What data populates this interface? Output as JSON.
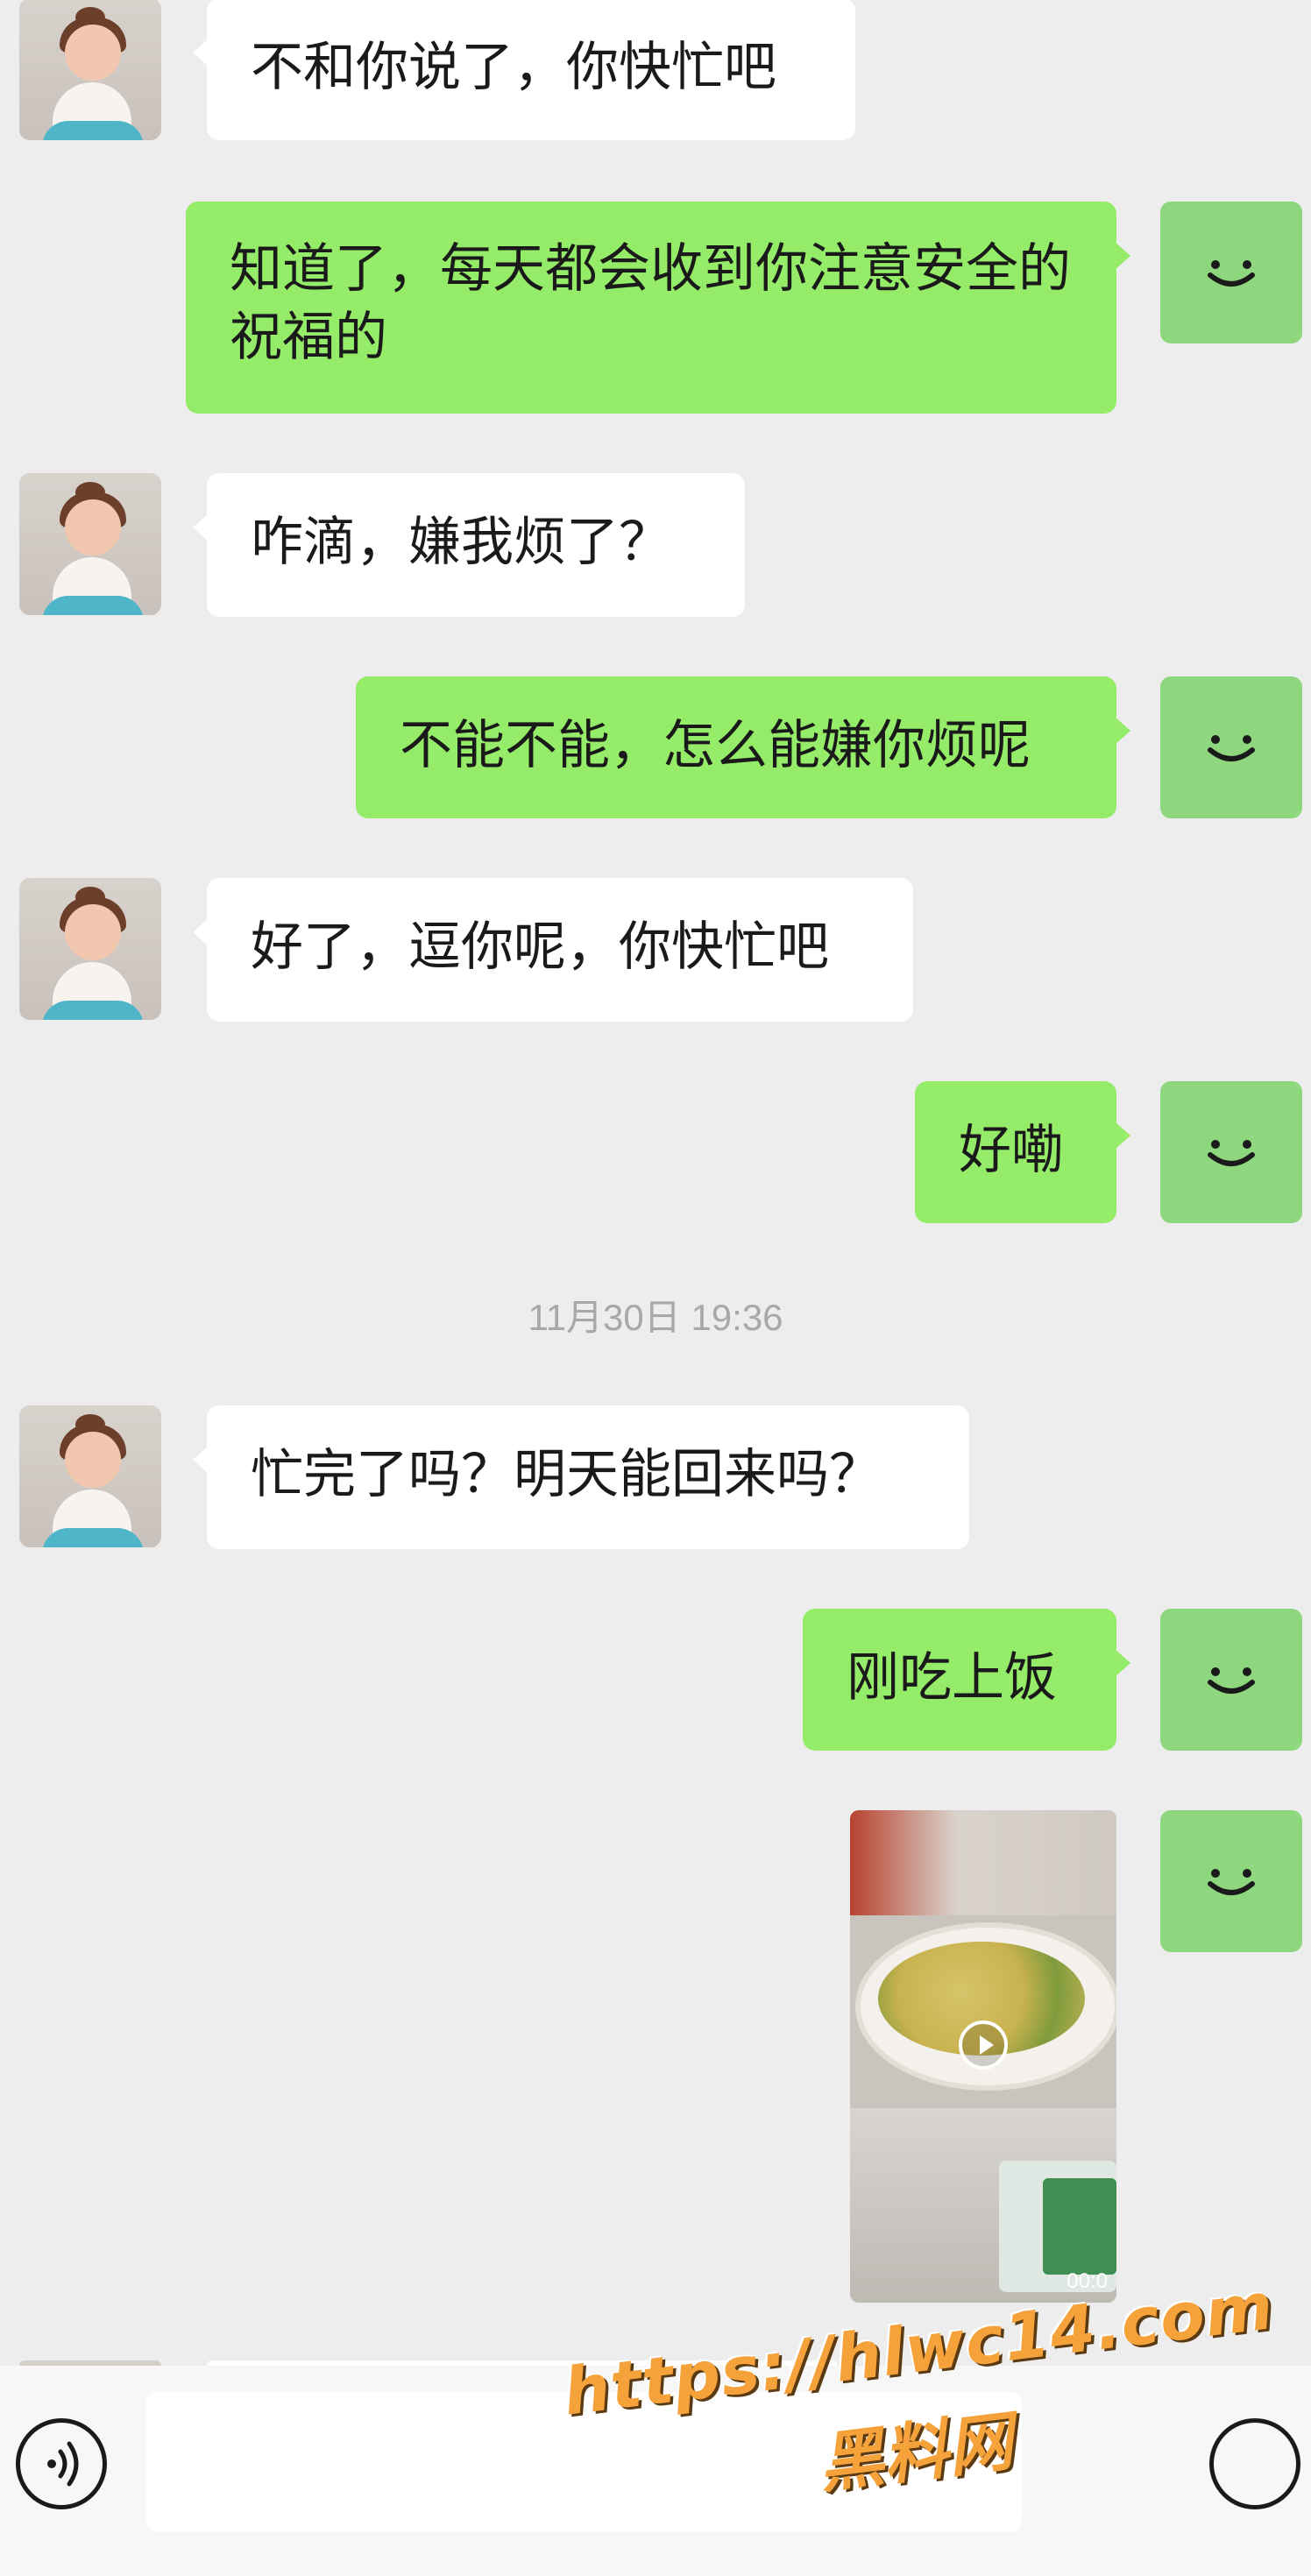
{
  "colors": {
    "background": "#ededed",
    "incoming_bubble": "#ffffff",
    "outgoing_bubble": "#95ec69",
    "my_avatar": "#8ed77e",
    "timestamp_text": "#a8a8a8",
    "watermark": "#f6a23b"
  },
  "messages": [
    {
      "side": "in",
      "text": "不和你说了，你快忙吧"
    },
    {
      "side": "out",
      "text": "知道了，每天都会收到你注意安全的祝福的"
    },
    {
      "side": "in",
      "text": "咋滴，嫌我烦了？"
    },
    {
      "side": "out",
      "text": "不能不能，怎么能嫌你烦呢"
    },
    {
      "side": "in",
      "text": "好了，逗你呢，你快忙吧"
    },
    {
      "side": "out",
      "text": "好嘞"
    },
    {
      "side": "in",
      "text": "忙完了吗？明天能回来吗？"
    },
    {
      "side": "out",
      "text": "刚吃上饭"
    }
  ],
  "timestamp": "11月30日 19:36",
  "video": {
    "duration": "00:0"
  },
  "watermark": {
    "url": "https://hlwc14.com",
    "name": "黑料网"
  },
  "icons": {
    "other_avatar": "cartoon-girl-avatar-icon",
    "my_avatar": "smiley-face-icon",
    "voice": "voice-input-icon",
    "emoji": "emoji-icon",
    "play": "play-icon"
  }
}
